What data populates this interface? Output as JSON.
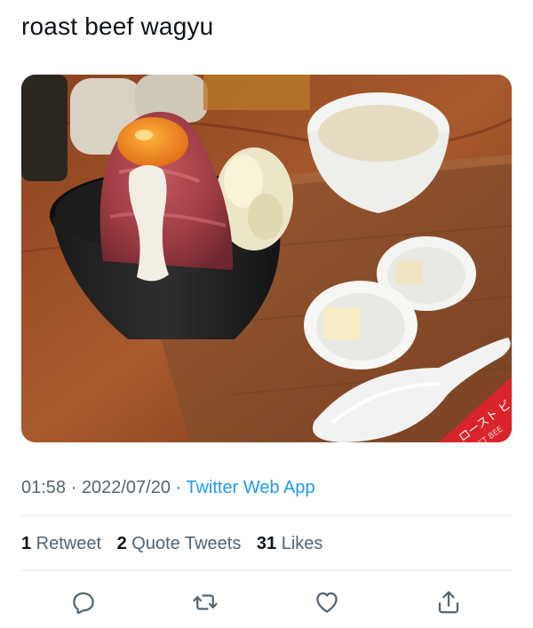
{
  "tweet": {
    "text": "roast beef wagyu"
  },
  "media": {
    "sign_text_top": "ロースト ビ ー",
    "sign_text_bottom": "AST BEE"
  },
  "meta": {
    "time": "01:58",
    "sep1": " · ",
    "date": "2022/07/20",
    "sep2": " · ",
    "source": "Twitter Web App"
  },
  "stats": {
    "retweets_count": "1",
    "retweets_label": " Retweet",
    "quotes_count": "2",
    "quotes_label": " Quote Tweets",
    "likes_count": "31",
    "likes_label": " Likes"
  },
  "actions": {
    "icons": [
      "reply-icon",
      "retweet-icon",
      "like-icon",
      "share-icon"
    ],
    "icon_color": "#536471"
  },
  "colors": {
    "text": "#0f1419",
    "muted": "#536471",
    "link": "#1d9bf0",
    "divider": "#e4e8ea"
  }
}
